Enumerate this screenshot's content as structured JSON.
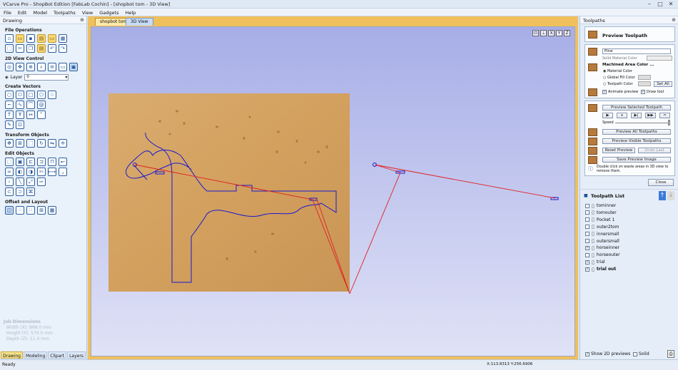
{
  "window": {
    "title": "VCarve Pro - ShopBot Edition [FabLab Cochin] - [shopbot tom - 3D View]",
    "min": "–",
    "max": "□",
    "close": "✕"
  },
  "menu": [
    "File",
    "Edit",
    "Model",
    "Toolpaths",
    "View",
    "Gadgets",
    "Help"
  ],
  "left_panel": {
    "title": "Drawing",
    "sections": {
      "file_ops": "File Operations",
      "view_control": "2D View Control",
      "create_vectors": "Create Vectors",
      "transform": "Transform Objects",
      "edit": "Edit Objects",
      "offset": "Offset and Layout"
    },
    "layer_label": "Layer",
    "layer_value": "0",
    "job": {
      "title": "Job Dimensions",
      "width": "Width  (X): 898.0 mm",
      "height": "Height (Y): 570.0 mm",
      "depth": "Depth  (Z): 11.0 mm"
    },
    "tabs": [
      "Drawing",
      "Modeling",
      "Clipart",
      "Layers"
    ]
  },
  "doc_tabs": [
    "shopbot tom",
    "3D View"
  ],
  "view_icons": [
    "fit-view-icon",
    "axis-icon",
    "zoom-x-icon",
    "zoom-y-icon",
    "zoom-z-icon"
  ],
  "right_panel": {
    "title": "Toolpaths",
    "preview_title": "Preview Toolpath",
    "material_dropdown": "Pine",
    "solid_material_label": "Solid Material Color",
    "machined_label": "Machined Area Color ...",
    "radio_material": "Material Color",
    "radio_global": "Global Fill Color",
    "radio_toolpath": "Toolpath Color",
    "set_all": "Set All",
    "animate": "Animate preview",
    "draw_tool": "Draw tool",
    "preview_selected": "Preview Selected Toolpath",
    "speed_label": "Speed",
    "preview_all": "Preview All Toolpaths",
    "preview_visible": "Preview Visible Toolpaths",
    "reset_preview": "Reset Preview",
    "undo_last": "Undo Last",
    "save_preview": "Save Preview Image",
    "help_text": "Double click on waste areas in 3D view to remove them.",
    "close": "Close",
    "list_title": "Toolpath List",
    "toolpaths": [
      {
        "name": "tominner",
        "checked": false,
        "bold": false
      },
      {
        "name": "tomouter",
        "checked": false,
        "bold": false
      },
      {
        "name": "Pocket 1",
        "checked": false,
        "bold": false
      },
      {
        "name": "outer2tom",
        "checked": false,
        "bold": false
      },
      {
        "name": "innersmall",
        "checked": false,
        "bold": false
      },
      {
        "name": "outersmall",
        "checked": false,
        "bold": false
      },
      {
        "name": "horseinner",
        "checked": true,
        "bold": false
      },
      {
        "name": "horseouter",
        "checked": false,
        "bold": false
      },
      {
        "name": "trial",
        "checked": true,
        "bold": false
      },
      {
        "name": "trial out",
        "checked": true,
        "bold": true
      }
    ],
    "show2d": "Show 2D previews",
    "solid": "Solid"
  },
  "status": {
    "left": "Ready",
    "coords": "X:113.8313 Y:256.6906"
  },
  "colors": {
    "accent": "#f0c05c",
    "toolpath_line": "#1a1ad0",
    "rapid_move": "#e02020",
    "wood": "#d6a566"
  }
}
